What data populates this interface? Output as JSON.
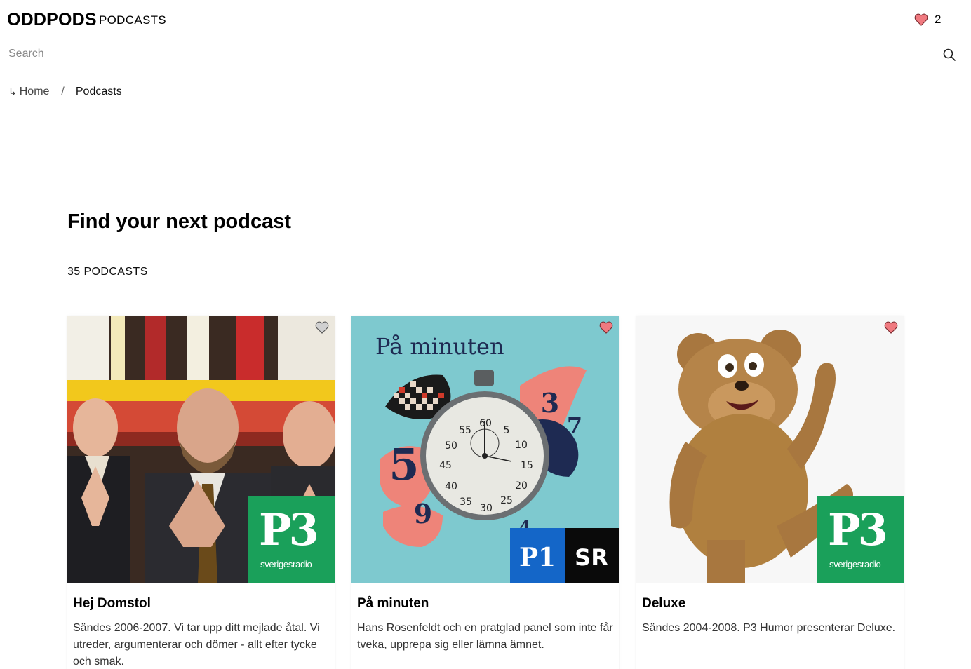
{
  "header": {
    "logo": "ODDPODS",
    "section": "PODCASTS",
    "favorites_count": "2"
  },
  "search": {
    "placeholder": "Search",
    "value": ""
  },
  "breadcrumb": {
    "home": "Home",
    "separator": "/",
    "current": "Podcasts"
  },
  "main": {
    "heading": "Find your next podcast",
    "count": "35 PODCASTS"
  },
  "podcasts": [
    {
      "title": "Hej Domstol",
      "description": "Sändes 2006-2007. Vi tar upp ditt mejlade åtal. Vi utreder, argumenterar och dömer - allt efter tycke och smak.",
      "favorited": false,
      "badge": "P3",
      "badge_sub": "sverigesradio"
    },
    {
      "title": "På minuten",
      "description": "Hans Rosenfeldt och en pratglad panel som inte får tveka, upprepa sig eller lämna ämnet.",
      "favorited": true,
      "cover_title": "På minuten",
      "badge_left": "P1",
      "badge_right": "SR",
      "dial_numbers": [
        "60",
        "5",
        "10",
        "15",
        "20",
        "25",
        "30",
        "35",
        "40",
        "45",
        "50",
        "55"
      ],
      "flag_numbers": [
        "3",
        "7",
        "5",
        "9",
        "4"
      ]
    },
    {
      "title": "Deluxe",
      "description": "Sändes 2004-2008. P3 Humor presenterar Deluxe.",
      "favorited": true,
      "badge": "P3",
      "badge_sub": "sverigesradio"
    }
  ],
  "colors": {
    "heart_filled": "#f07a80",
    "heart_empty": "#d0d0d0",
    "p3_green": "#1aa05a",
    "p1_blue": "#1466c8",
    "cover_teal": "#7ec9cf"
  }
}
